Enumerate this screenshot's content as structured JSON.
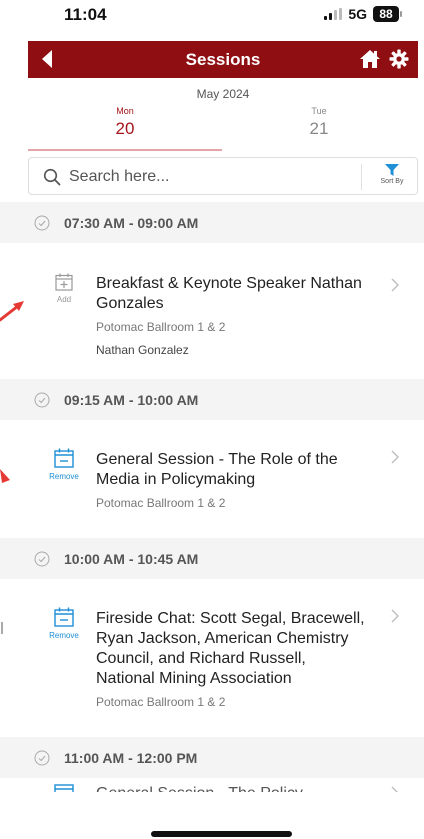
{
  "status_bar": {
    "time": "11:04",
    "network": "5G",
    "battery": "88"
  },
  "header": {
    "title": "Sessions",
    "back_icon": "back-arrow-icon",
    "home_icon": "home-icon",
    "settings_icon": "gear-icon",
    "color": "#8e0e11"
  },
  "date_bar": {
    "month": "May 2024",
    "tabs": [
      {
        "dow": "Mon",
        "day": "20",
        "active": true
      },
      {
        "dow": "Tue",
        "day": "21",
        "active": false
      }
    ],
    "accent": "#a4151a"
  },
  "search": {
    "placeholder": "Search here...",
    "sort_label": "Sort By"
  },
  "slots": [
    {
      "time": "07:30 AM - 09:00 AM",
      "sessions": [
        {
          "title": "Breakfast & Keynote Speaker Nathan Gonzales",
          "location": "Potomac Ballroom 1 & 2",
          "speaker": "Nathan Gonzalez",
          "action": "Add"
        }
      ]
    },
    {
      "time": "09:15 AM - 10:00 AM",
      "sessions": [
        {
          "title": "General Session - The Role of the Media in Policymaking",
          "location": "Potomac Ballroom 1 & 2",
          "action": "Remove"
        }
      ]
    },
    {
      "time": "10:00 AM - 10:45 AM",
      "sessions": [
        {
          "title": "Fireside Chat: Scott Segal, Bracewell, Ryan Jackson, American Chemistry Council, and Richard Russell, National Mining Association",
          "location": "Potomac Ballroom 1 & 2",
          "action": "Remove"
        }
      ]
    },
    {
      "time": "11:00 AM - 12:00 PM",
      "sessions": [
        {
          "title": "General Session - The Policy",
          "action": "Remove"
        }
      ]
    }
  ],
  "colors": {
    "add_gray": "#999999",
    "remove_blue": "#1f8fd6",
    "annotation_red": "#e53935"
  }
}
